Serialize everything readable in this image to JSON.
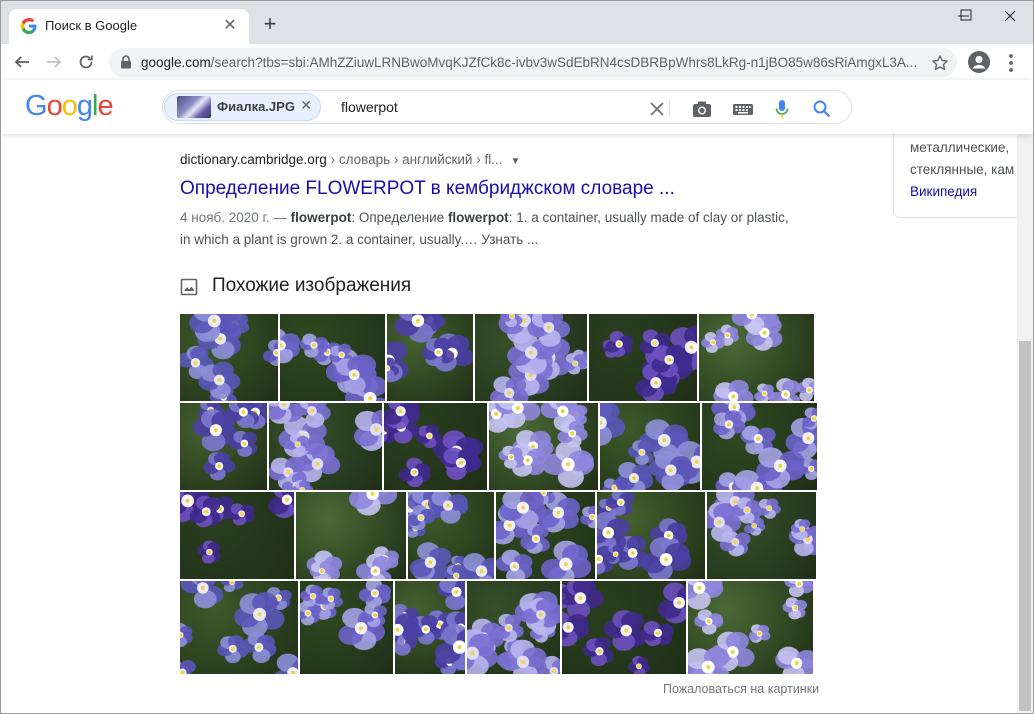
{
  "browser": {
    "tab_title": "Поиск в Google",
    "url_host": "google.com",
    "url_rest": "/search?tbs=sbi:AMhZZiuwLRNBwoMvqKJZfCk8c-ivbv3wSdEbRN4csDBRBpWhrs8LkRg-n1jBO85w86sRiAmgxL3A..."
  },
  "search": {
    "chip_label": "Фиалка.JPG",
    "query": "flowerpot"
  },
  "result": {
    "cite_host": "dictionary.cambridge.org",
    "cite_path": " › словарь › английский › fl...",
    "title": "Определение FLOWERPOT в кембриджском словаре ...",
    "date": "4 нояб. 2020 г. — ",
    "snippet_bold_1": "flowerpot",
    "snippet_mid": ": Определение ",
    "snippet_bold_2": "flowerpot",
    "snippet_tail": ": 1. a container, usually made of clay or plastic, in which a plant is grown 2. a container, usually.… Узнать ..."
  },
  "similar": {
    "heading": "Похожие изображения",
    "report_link": "Пожаловаться на картинки"
  },
  "knowledge_panel": {
    "line1": "металлические,",
    "line2": "стеклянные, кам",
    "source_link": "Википедия"
  },
  "colors": {
    "link": "#1a0dab",
    "tabstrip": "#dee1e6",
    "omnibox": "#f1f3f4",
    "mic_blue": "#4285f4",
    "mic_red": "#ea4335"
  }
}
